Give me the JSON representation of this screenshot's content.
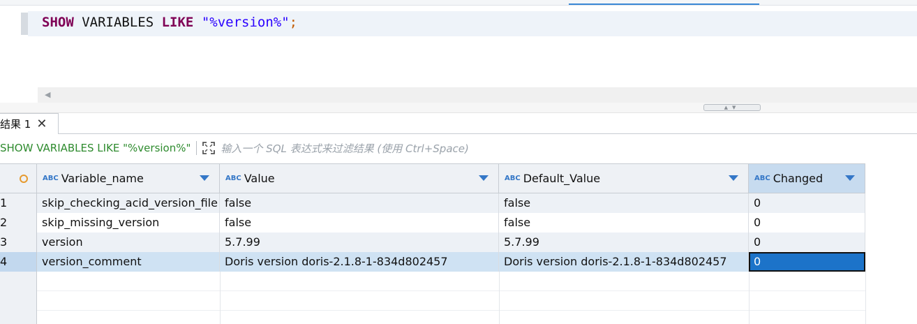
{
  "editor": {
    "sql_keyword_show": "SHOW",
    "sql_variables": " VARIABLES ",
    "sql_keyword_like": "LIKE",
    "sql_string": " \"%version%\"",
    "sql_semicolon": ";"
  },
  "results": {
    "tab_label": "结果 1",
    "filter_query": "SHOW VARIABLES LIKE \"%version%\"",
    "filter_placeholder": "输入一个 SQL 表达式来过滤结果 (使用 Ctrl+Space)",
    "type_badge": "ABC",
    "columns": [
      "Variable_name",
      "Value",
      "Default_Value",
      "Changed"
    ],
    "rows": [
      {
        "num": "1",
        "cells": [
          "skip_checking_acid_version_file",
          "false",
          "false",
          "0"
        ]
      },
      {
        "num": "2",
        "cells": [
          "skip_missing_version",
          "false",
          "false",
          "0"
        ]
      },
      {
        "num": "3",
        "cells": [
          "version",
          "5.7.99",
          "5.7.99",
          "0"
        ]
      },
      {
        "num": "4",
        "cells": [
          "version_comment",
          "Doris version doris-2.1.8-1-834d802457",
          "Doris version doris-2.1.8-1-834d802457",
          "0"
        ]
      }
    ],
    "selected_column": "Changed",
    "selected_row": "4"
  },
  "colors": {
    "keyword": "#7f0055",
    "string": "#2a00ff",
    "filter_text": "#2e8b2e",
    "type_badge": "#3477c7",
    "focus_cell": "#1c73c9"
  },
  "icons": {
    "tab_close": "close-icon",
    "filter_expand": "expand-icon",
    "column_sort": "dropdown-triangle-icon",
    "row_header": "circle-icon"
  }
}
